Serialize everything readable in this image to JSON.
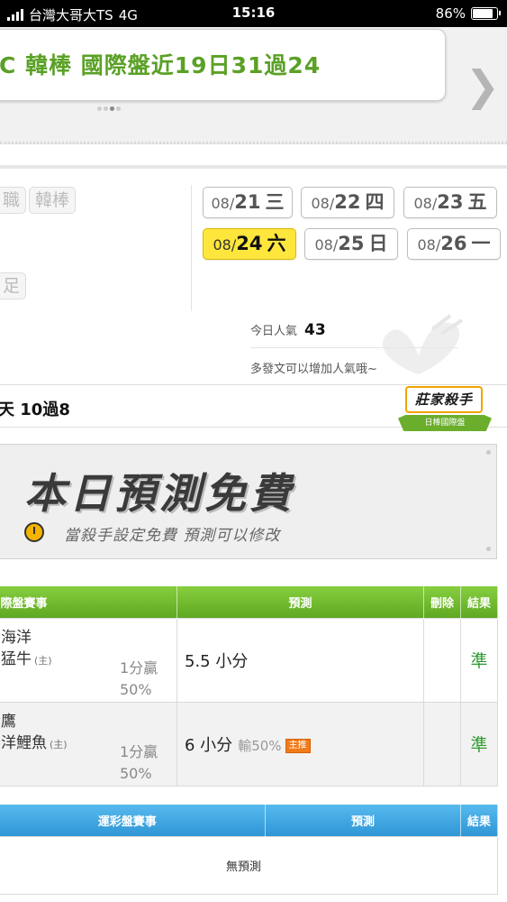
{
  "status_bar": {
    "carrier": "台灣大哥大TS",
    "network": "4G",
    "time": "15:16",
    "battery": "86%"
  },
  "hero": {
    "title": "韓棒 國際盤近19日31過24",
    "partial_glyph": "C"
  },
  "categories": {
    "tag1": "職",
    "tag2": "韓棒",
    "tag3": "足"
  },
  "dates": [
    {
      "md": "08/",
      "day": "21",
      "wd": "三"
    },
    {
      "md": "08/",
      "day": "22",
      "wd": "四"
    },
    {
      "md": "08/",
      "day": "23",
      "wd": "五"
    },
    {
      "md": "08/",
      "day": "24",
      "wd": "六"
    },
    {
      "md": "08/",
      "day": "25",
      "wd": "日"
    },
    {
      "md": "08/",
      "day": "26",
      "wd": "一"
    }
  ],
  "popularity": {
    "label": "今日人氣",
    "value": "43",
    "hint": "多發文可以增加人氣哦~"
  },
  "streak": "天 10過8",
  "badge": {
    "title": "莊家殺手",
    "sub": "日棒國際盤"
  },
  "banner": {
    "title": "本日預測免費",
    "subtitle": "當殺手設定免費 預測可以修改"
  },
  "intl_table": {
    "headers": {
      "match": "際盤賽事",
      "prediction": "預測",
      "delete": "刪除",
      "result": "結果"
    },
    "rows": [
      {
        "away": "海洋",
        "home": "猛牛",
        "home_mark": "(主)",
        "odds": "1分贏",
        "odds_pct": "50%",
        "prediction": "5.5 小分",
        "extra": "",
        "hot": "",
        "result": "準"
      },
      {
        "away": "鷹",
        "home": "洋鯉魚",
        "home_mark": "(主)",
        "odds": "1分贏",
        "odds_pct": "50%",
        "prediction": "6 小分",
        "extra": "輸50%",
        "hot": "主推",
        "result": "準"
      }
    ]
  },
  "sports_table": {
    "headers": {
      "match": "運彩盤賽事",
      "prediction": "預測",
      "result": "結果"
    },
    "empty": "無預測"
  },
  "colors": {
    "green": "#5aa126",
    "blue": "#2f97d6",
    "selected_date": "#ffe63c"
  }
}
